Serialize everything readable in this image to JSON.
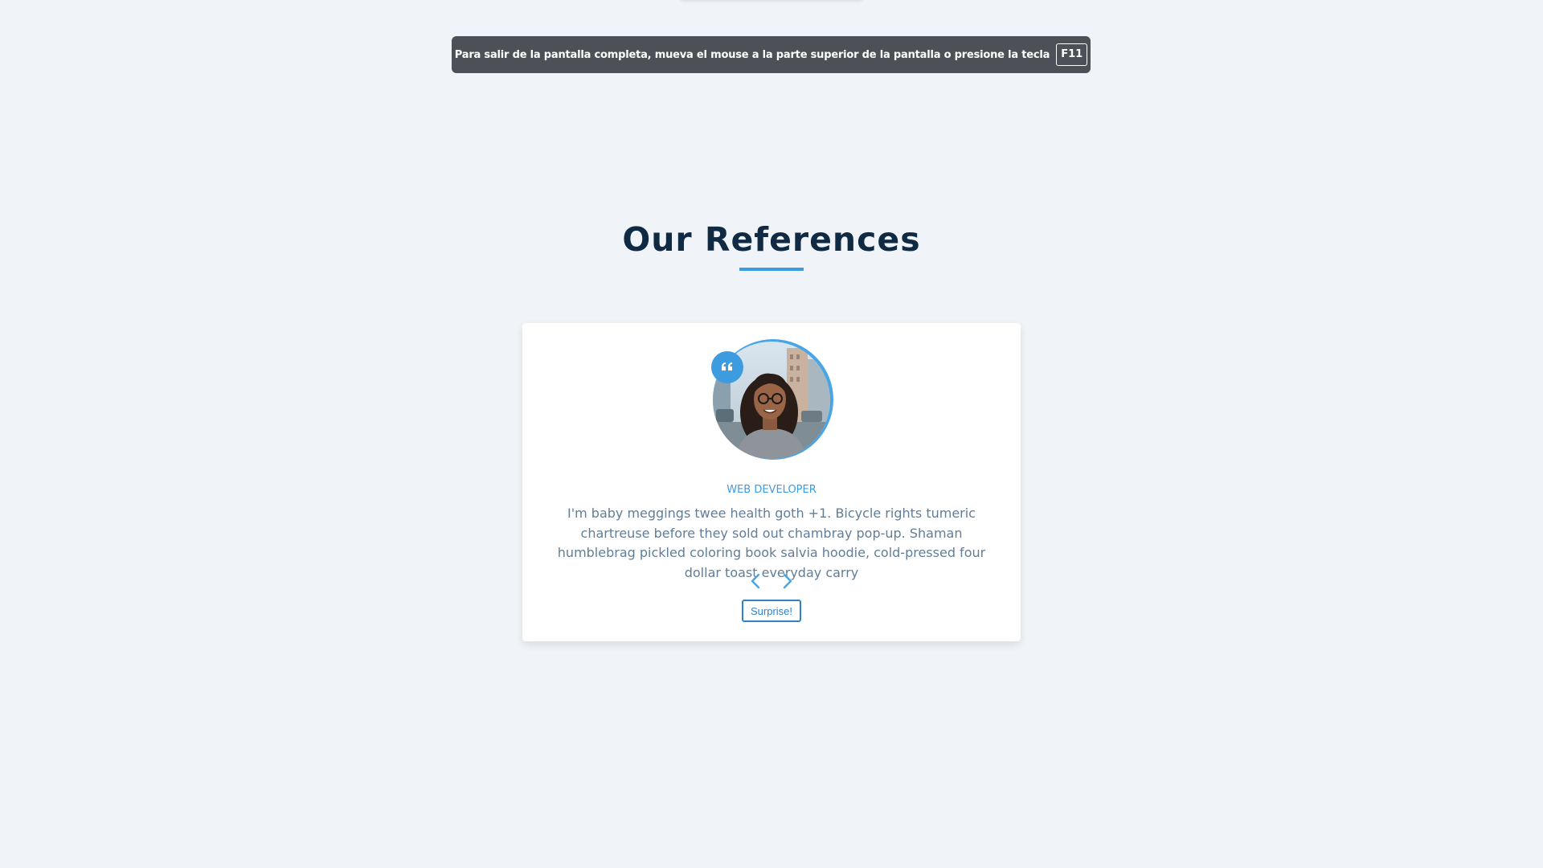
{
  "fullscreen_banner": {
    "message": "Para salir de la pantalla completa, mueva el mouse a la parte superior de la pantalla o presione la tecla",
    "key": "F11"
  },
  "section": {
    "title": "Our References"
  },
  "review": {
    "job": "WEB DEVELOPER",
    "text": "I'm baby meggings twee health goth +1. Bicycle rights tumeric chartreuse before they sold out chambray pop-up. Shaman humblebrag pickled coloring book salvia hoodie, cold-pressed four dollar toast everyday carry",
    "button_label": "Surprise!"
  },
  "icons": {
    "quote": "quote-icon",
    "prev": "chevron-left-icon",
    "next": "chevron-right-icon"
  },
  "colors": {
    "background": "#f0f4f8",
    "accent": "#3d9be0",
    "title": "#102a43",
    "body_text": "#617d98",
    "banner": "#4d5157"
  }
}
